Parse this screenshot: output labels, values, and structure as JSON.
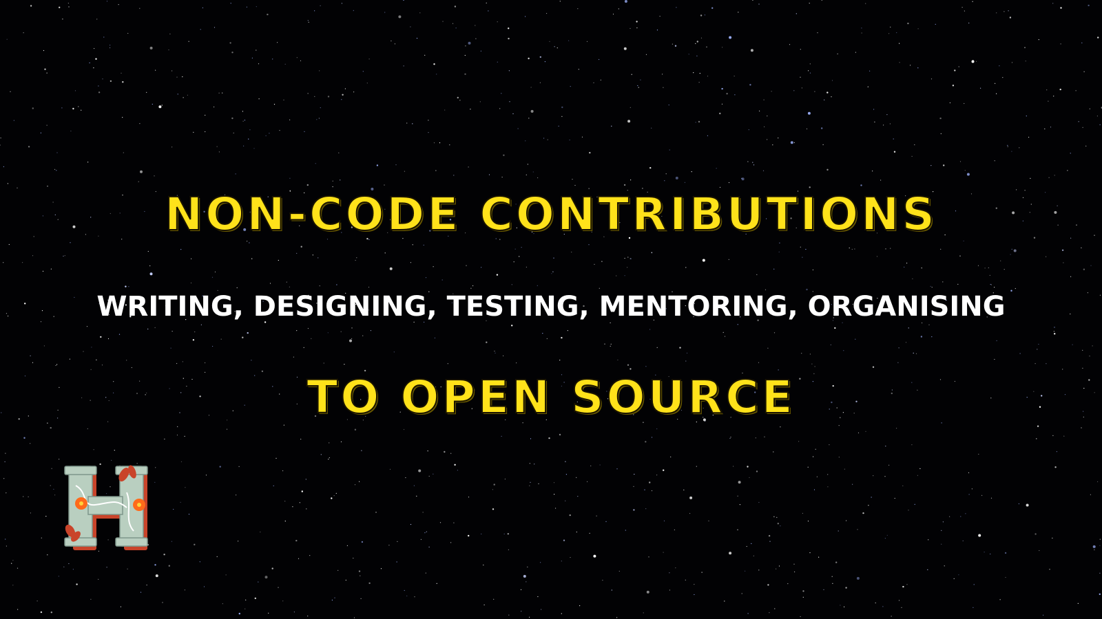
{
  "headline_top": "NON-CODE CONTRIBUTIONS",
  "subtitle": "WRITING, DESIGNING, TESTING, MENTORING, ORGANISING",
  "headline_bottom": "TO OPEN SOURCE",
  "colors": {
    "background": "#020204",
    "headline": "#ffe21a",
    "subtitle": "#ffffff",
    "logo_letter": "#b9cfc0",
    "logo_shadow": "#c9442a",
    "logo_flower": "#ff6a1a"
  },
  "logo": {
    "icon": "illuminated-letter-h-icon",
    "letter": "H"
  }
}
